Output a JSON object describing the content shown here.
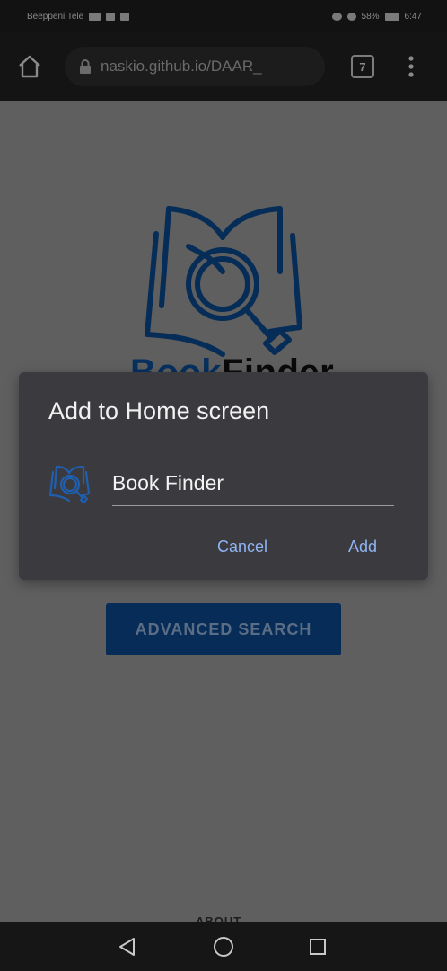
{
  "status_bar": {
    "carrier": "Beeppeni Tele",
    "battery": "58%",
    "time": "6:47"
  },
  "browser": {
    "url": "naskio.github.io/DAAR_",
    "tab_count": "7"
  },
  "page": {
    "brand_part1": "Book",
    "brand_part2": "Finder",
    "advanced_search_label": "ADVANCED SEARCH",
    "about_label": "ABOUT"
  },
  "dialog": {
    "title": "Add to Home screen",
    "app_name": "Book Finder",
    "cancel_label": "Cancel",
    "add_label": "Add"
  },
  "icons": {
    "home": "home-icon",
    "lock": "lock-icon",
    "menu": "more-vert-icon",
    "logo": "book-magnifier-icon",
    "back": "back-triangle-icon",
    "nav_home": "circle-home-icon",
    "recents": "square-recents-icon"
  },
  "colors": {
    "accent": "#8fb4f3",
    "brand_blue": "#07305f",
    "dialog_bg": "#3b3a3f",
    "scrim": "#5f5f5f"
  }
}
